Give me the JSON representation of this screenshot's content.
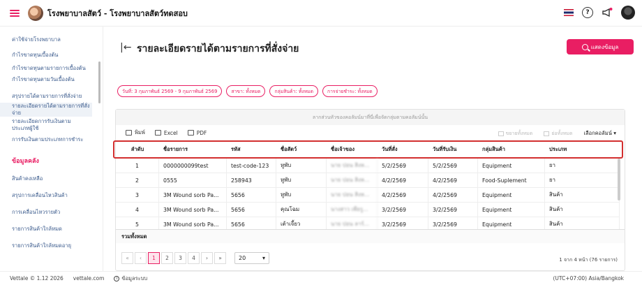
{
  "header": {
    "app_title": "โรงพยาบาลสัตว์ - โรงพยาบาลสัตว์ทดสอบ",
    "help_label": "?"
  },
  "sidebar": {
    "items": [
      {
        "label": "ค่าใช้จ่ายโรงพยาบาล"
      },
      {
        "label": "กำไรขาดทุนเบื้องต้น"
      },
      {
        "label": "กำไรขาดทุนตามรายการเบื้องต้น"
      },
      {
        "label": "กำไรขาดทุนตามวันเบื้องต้น"
      },
      {
        "label": "สรุปรายได้ตามรายการที่สั่งจ่าย"
      },
      {
        "label": "รายละเอียดรายได้ตามรายการที่สั่งจ่าย"
      },
      {
        "label": "รายละเอียดการรับเงินตามประเภทผู้ใช้"
      },
      {
        "label": "การรับเงินตามประเภทการชำระ"
      }
    ],
    "section_title": "ข้อมูลคลัง",
    "section_items": [
      {
        "label": "สินค้าคงเหลือ"
      },
      {
        "label": "สรุปการเคลื่อนไหวสินค้า"
      },
      {
        "label": "การเคลื่อนไหวรายตัว"
      },
      {
        "label": "รายการสินค้าใกล้หมด"
      },
      {
        "label": "รายการสินค้าใกล้หมดอายุ"
      }
    ]
  },
  "main": {
    "title": "รายละเอียดรายได้ตามรายการที่สั่งจ่าย",
    "show_button": "แสดงข้อมูล",
    "filters": [
      "วันที่: 3 กุมภาพันธ์ 2569 - 9 กุมภาพันธ์ 2569",
      "สาขา: ทั้งหมด",
      "กลุ่มสินค้า: ทั้งหมด",
      "การจ่ายชำระ: ทั้งหมด"
    ]
  },
  "grid": {
    "group_hint": "ลากส่วนหัวของคอลัมน์มาที่นี่เพื่อจัดกลุ่มตามคอลัมน์นั้น",
    "toolbar": {
      "print": "พิมพ์",
      "excel": "Excel",
      "pdf": "PDF",
      "expand_all": "ขยายทั้งหมด",
      "collapse_all": "ย่อทั้งหมด",
      "column_chooser": "เลือกคอลัมน์"
    },
    "columns": [
      "ลำดับ",
      "ชื่อรายการ",
      "รหัส",
      "ชื่อสัตว์",
      "ชื่อเจ้าของ",
      "วันที่สั่ง",
      "วันที่รับเงิน",
      "กลุ่มสินค้า",
      "ประเภท"
    ],
    "rows": [
      [
        "1",
        "0000000099test",
        "test-code-123",
        "หูพับ",
        "นาย ปอน สิงห...",
        "5/2/2569",
        "5/2/2569",
        "Equipment",
        "ยา"
      ],
      [
        "2",
        "0555",
        "258943",
        "หูพับ",
        "นาย ปอน สิงห...",
        "4/2/2569",
        "4/2/2569",
        "Food-Suplement",
        "ยา"
      ],
      [
        "3",
        "3M Wound sorb Pa...",
        "5656",
        "หูพับ",
        "นาย ปอน สิงห...",
        "4/2/2569",
        "4/2/2569",
        "Equipment",
        "สินค้า"
      ],
      [
        "4",
        "3M Wound sorb Pa...",
        "5656",
        "คุณโฉม",
        "นางสาว เพียรู...",
        "3/2/2569",
        "3/2/2569",
        "Equipment",
        "สินค้า"
      ],
      [
        "5",
        "3M Wound sorb Pa...",
        "5656",
        "เต้าเจี้ยว",
        "นาย ปอน ลาร์...",
        "3/2/2569",
        "3/2/2569",
        "Equipment",
        "สินค้า"
      ]
    ],
    "total_label": "รวมทั้งหมด",
    "pager": {
      "pages": [
        "1",
        "2",
        "3",
        "4"
      ],
      "current_page": "1",
      "page_size": "20",
      "info": "1 จาก 4 หน้า (76 รายการ)"
    }
  },
  "footer": {
    "version": "Vettale © 1.12 2026",
    "site": "vettale.com",
    "system_info": "ข้อมูลระบบ",
    "timezone": "(UTC+07:00) Asia/Bangkok"
  },
  "colors": {
    "accent": "#e91e63",
    "sidebar_link": "#3a5a8c",
    "highlight_box": "#d32f2f"
  }
}
